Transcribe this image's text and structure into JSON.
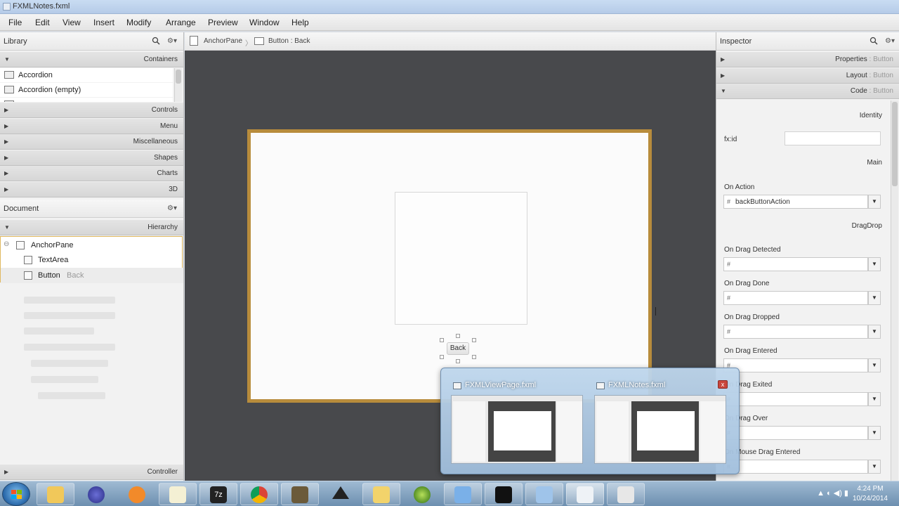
{
  "window": {
    "title": "FXMLNotes.fxml"
  },
  "menu": [
    "File",
    "Edit",
    "View",
    "Insert",
    "Modify",
    "Arrange",
    "Preview",
    "Window",
    "Help"
  ],
  "library": {
    "title": "Library",
    "sections": [
      "Containers",
      "Controls",
      "Menu",
      "Miscellaneous",
      "Shapes",
      "Charts",
      "3D"
    ],
    "items": [
      "Accordion",
      "Accordion  (empty)"
    ]
  },
  "document": {
    "title": "Document",
    "hierarchy_label": "Hierarchy",
    "tree": [
      {
        "label": "AnchorPane"
      },
      {
        "label": "TextArea"
      },
      {
        "label": "Button",
        "detail": "Back"
      }
    ],
    "controller_label": "Controller"
  },
  "canvas": {
    "breadcrumb_root": "AnchorPane",
    "breadcrumb_leaf": "Button : Back",
    "button_text": "Back"
  },
  "inspector": {
    "title": "Inspector",
    "sections": [
      {
        "label": "Properties",
        "suffix": " : Button"
      },
      {
        "label": "Layout",
        "suffix": " : Button"
      },
      {
        "label": "Code",
        "suffix": " : Button"
      }
    ],
    "identity_label": "Identity",
    "fxid_label": "fx:id",
    "main_label": "Main",
    "on_action_label": "On Action",
    "on_action_value": "backButtonAction",
    "dragdrop_label": "DragDrop",
    "drag_events": [
      "On Drag Detected",
      "On Drag Done",
      "On Drag Dropped",
      "On Drag Entered",
      "On Drag Exited",
      "On Drag Over",
      "On Mouse Drag Entered"
    ],
    "hash": "#"
  },
  "popup": {
    "thumbs": [
      {
        "title": "FXMLViewPage.fxml"
      },
      {
        "title": "FXMLNotes.fxml"
      }
    ],
    "close": "x"
  },
  "taskbar": {
    "time": "4:24 PM",
    "date": "10/24/2014",
    "icons": [
      "explorer-icon",
      "eclipse-icon",
      "media-player-icon",
      "notepad-icon",
      "7zip-icon",
      "chrome-icon",
      "settings-icon",
      "unity-icon",
      "folder-icon",
      "itunes-icon",
      "virtualbox-icon",
      "terminal-icon",
      "document-icon",
      "scenebuilder-icon",
      "java-icon"
    ]
  }
}
